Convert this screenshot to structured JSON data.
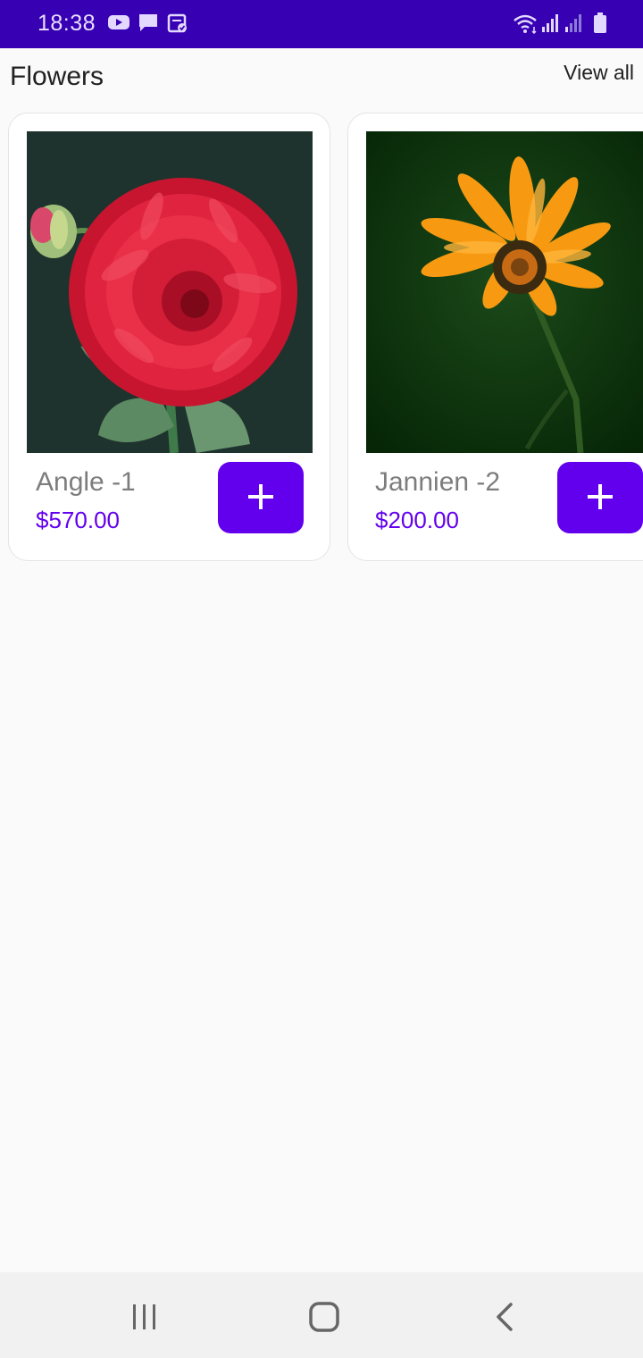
{
  "status_bar": {
    "time": "18:38",
    "bg_color": "#3700b3",
    "left_icons": [
      "youtube-icon",
      "message-icon",
      "calendar-check-icon"
    ],
    "right_icons": [
      "wifi-icon",
      "signal-icon",
      "signal-weak-icon",
      "battery-icon"
    ]
  },
  "header": {
    "title": "Flowers",
    "view_all_label": "View all"
  },
  "products": [
    {
      "name": "Angle -1",
      "price": "$570.00",
      "image": "red-dahlia-image",
      "add_icon": "plus-icon"
    },
    {
      "name": "Jannien -2",
      "price": "$200.00",
      "image": "orange-daisy-image",
      "add_icon": "plus-icon"
    }
  ],
  "colors": {
    "accent": "#6200ee",
    "status_bar": "#3700b3",
    "background": "#fafafa"
  },
  "nav_bar": {
    "buttons": [
      "recent-apps-icon",
      "home-icon",
      "back-icon"
    ]
  }
}
